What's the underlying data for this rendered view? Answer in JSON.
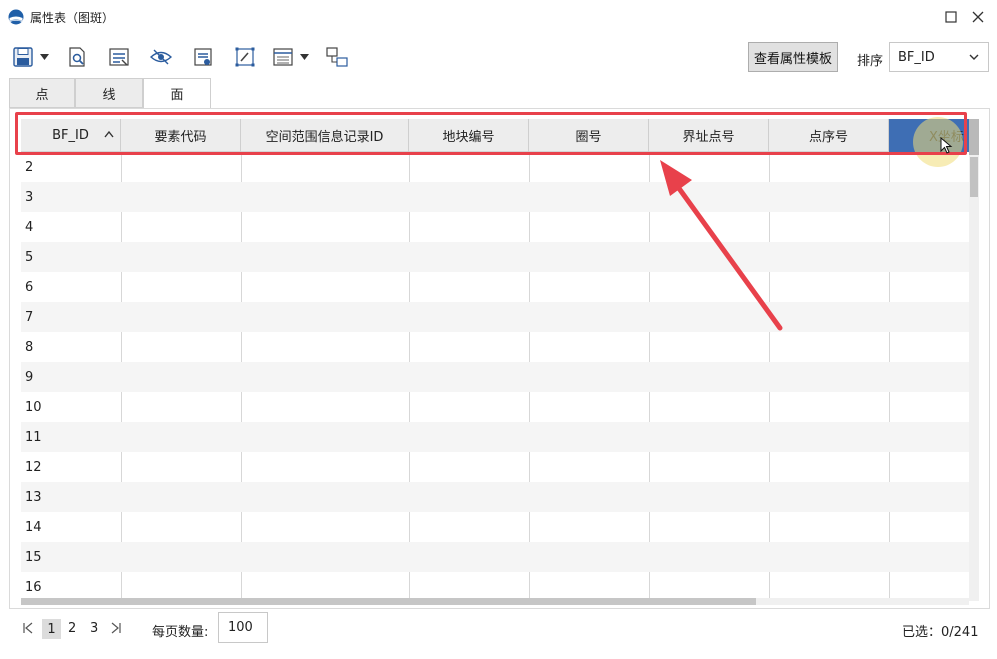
{
  "window": {
    "title": "属性表（图斑）"
  },
  "toolbar": {
    "icons": [
      "save-icon",
      "zoom-to-icon",
      "field-calc-icon",
      "visibility-icon",
      "attribute-icon",
      "edit-icon",
      "table-options-icon",
      "relate-icon"
    ]
  },
  "view_template_label": "查看属性模板",
  "sort": {
    "label": "排序",
    "value": "BF_ID"
  },
  "tabs": [
    {
      "label": "点"
    },
    {
      "label": "线"
    },
    {
      "label": "面"
    }
  ],
  "table": {
    "columns": [
      "BF_ID",
      "要素代码",
      "空间范围信息记录ID",
      "地块编号",
      "圈号",
      "界址点号",
      "点序号",
      "X坐标"
    ],
    "rows": [
      "2",
      "3",
      "4",
      "5",
      "6",
      "7",
      "8",
      "9",
      "10",
      "11",
      "12",
      "13",
      "14",
      "15",
      "16"
    ]
  },
  "pager": {
    "pages": [
      "1",
      "2",
      "3"
    ],
    "current": "1",
    "page_size_label": "每页数量:",
    "page_size_value": "100",
    "selected": "已选：0/241"
  },
  "colors": {
    "selected_header": "#3e6eb4",
    "highlight": "#e8414b"
  }
}
